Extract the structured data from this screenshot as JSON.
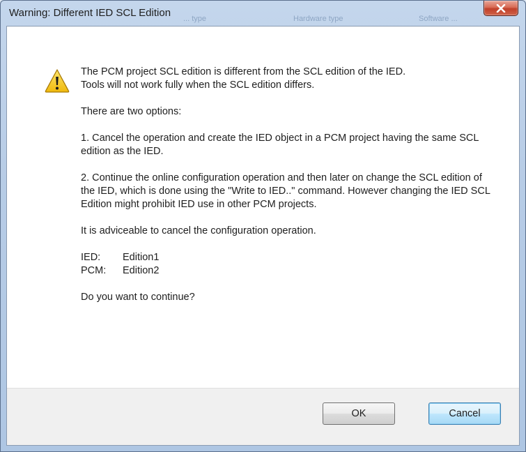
{
  "window": {
    "title": "Warning: Different IED SCL Edition",
    "background_text": [
      "... type",
      "Hardware type",
      "Software ..."
    ]
  },
  "icons": {
    "close": "close-icon",
    "warning": "warning-triangle-icon"
  },
  "message": {
    "lines": [
      "The PCM project SCL edition is different from the SCL edition of the IED.",
      "Tools will not work fully when the SCL edition differs."
    ],
    "options_intro": "There are two options:",
    "option1": "1. Cancel the operation and create the IED object in a PCM project having the same SCL edition as the IED.",
    "option2": "2. Continue the online configuration operation and then later on change the SCL edition of the IED, which is done using the \"Write to IED..\" command. However changing the IED SCL Edition might prohibit IED use in other PCM projects.",
    "advice": "It is adviceable to cancel the configuration operation.",
    "editions": [
      {
        "key": "IED:",
        "value": "Edition1"
      },
      {
        "key": "PCM:",
        "value": "Edition2"
      }
    ],
    "question": "Do you want to continue?"
  },
  "buttons": {
    "ok": "OK",
    "cancel": "Cancel"
  },
  "colors": {
    "warning_yellow": "#f2c418",
    "close_red": "#c8452f",
    "default_button_blue": "#3c7fb1"
  }
}
